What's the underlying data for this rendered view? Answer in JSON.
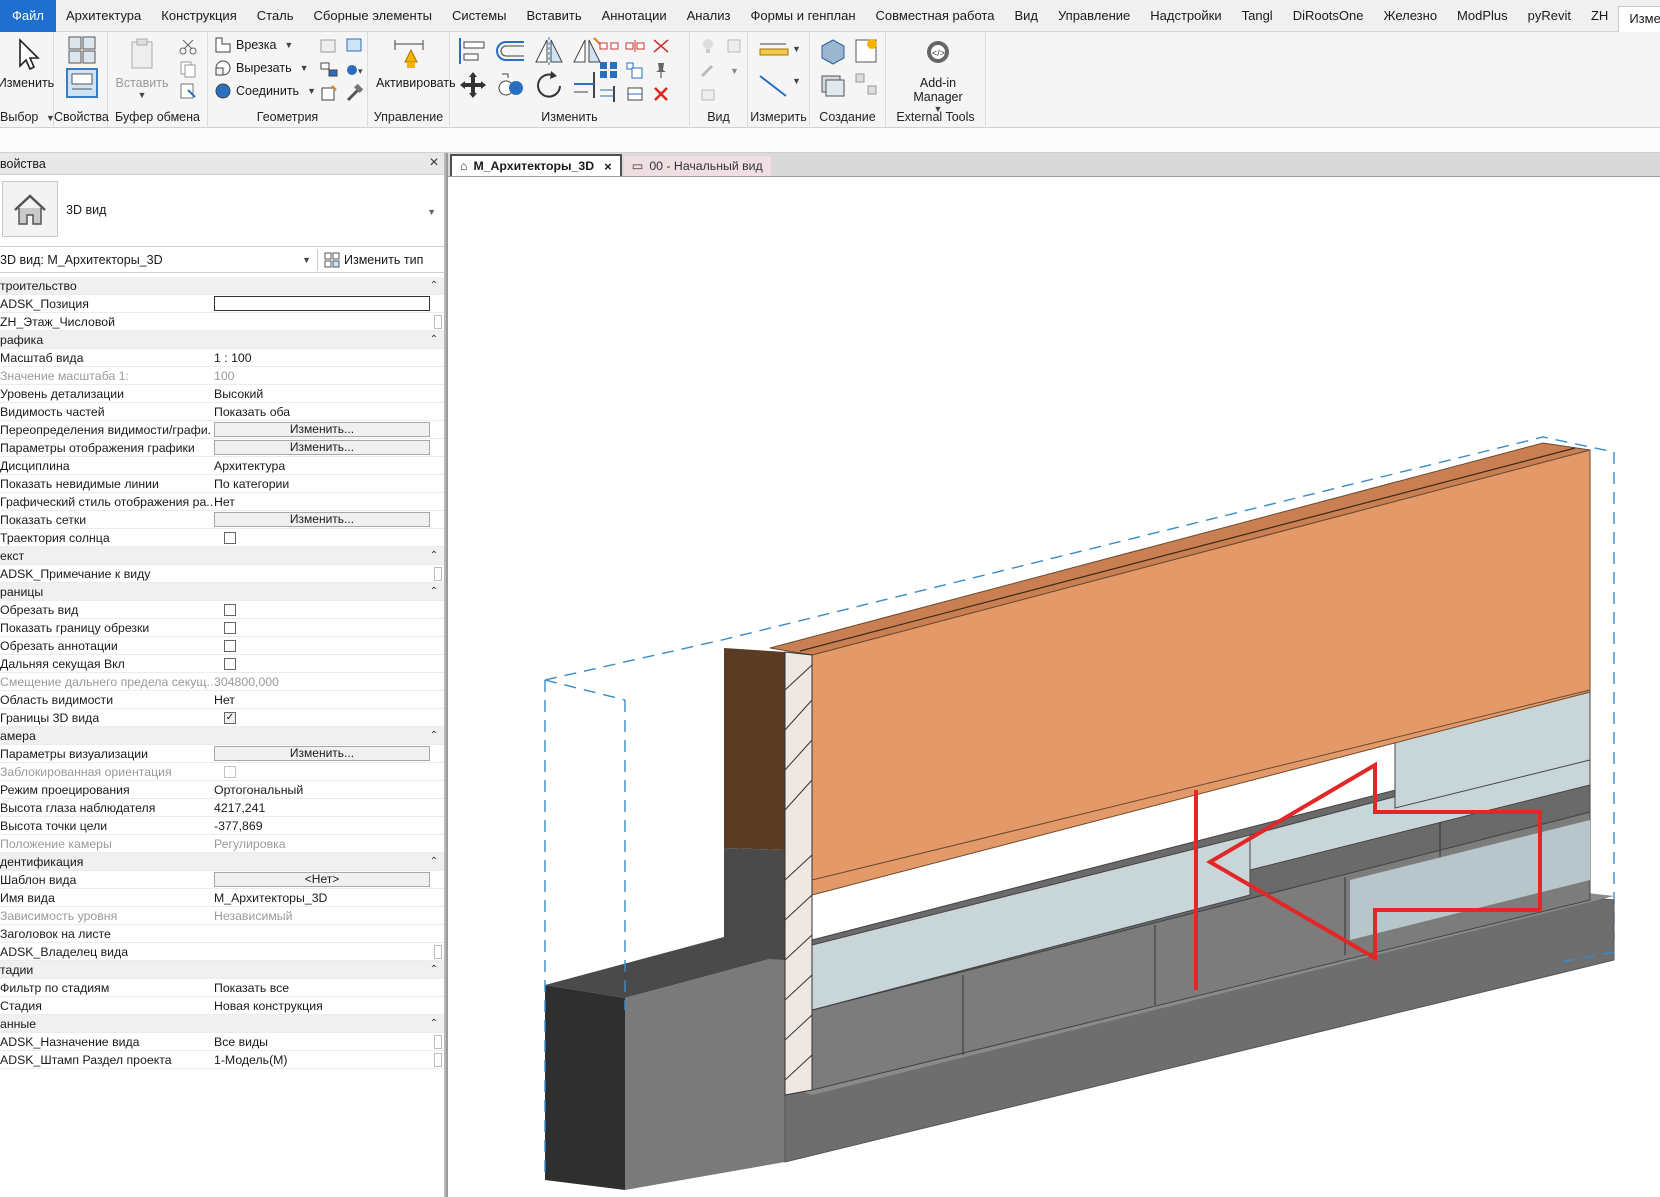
{
  "ribbon_tabs": [
    "Файл",
    "Архитектура",
    "Конструкция",
    "Сталь",
    "Сборные элементы",
    "Системы",
    "Вставить",
    "Аннотации",
    "Анализ",
    "Формы и генплан",
    "Совместная работа",
    "Вид",
    "Управление",
    "Надстройки",
    "Tangl",
    "DiRootsOne",
    "Железно",
    "ModPlus",
    "pyRevit",
    "ZH",
    "Изменить"
  ],
  "ribbon": {
    "select": {
      "btn": "Изменить",
      "title": "Выбор"
    },
    "properties": {
      "title": "Свойства"
    },
    "clipboard": {
      "paste": "Вставить",
      "title": "Буфер обмена"
    },
    "geometry": {
      "cope": "Врезка",
      "cut": "Вырезать",
      "join": "Соединить",
      "title": "Геометрия"
    },
    "control": {
      "activate": "Активировать",
      "title": "Управление"
    },
    "modify": {
      "title": "Изменить"
    },
    "view": {
      "title": "Вид"
    },
    "measure": {
      "title": "Измерить"
    },
    "create": {
      "title": "Создание"
    },
    "external": {
      "btn": "Add-in Manager",
      "title": "External Tools"
    }
  },
  "properties": {
    "header": "войства",
    "type_name": "3D вид",
    "selector": "3D вид: М_Архитекторы_3D",
    "edit_type": "Изменить тип",
    "rows": [
      {
        "kind": "group",
        "k": "троительство"
      },
      {
        "kind": "input",
        "k": "ADSK_Позиция"
      },
      {
        "kind": "text",
        "k": "ZH_Этаж_Числовой",
        "v": "",
        "scroll": true
      },
      {
        "kind": "group",
        "k": "рафика"
      },
      {
        "kind": "text",
        "k": "Масштаб вида",
        "v": " 1 : 100"
      },
      {
        "kind": "text",
        "k": "Значение масштаба    1:",
        "v": "100",
        "dis": true
      },
      {
        "kind": "text",
        "k": "Уровень детализации",
        "v": "Высокий"
      },
      {
        "kind": "text",
        "k": "Видимость частей",
        "v": "Показать оба"
      },
      {
        "kind": "btn",
        "k": "Переопределения видимости/графи...",
        "v": "Изменить..."
      },
      {
        "kind": "btn",
        "k": "Параметры отображения графики",
        "v": "Изменить..."
      },
      {
        "kind": "text",
        "k": "Дисциплина",
        "v": "Архитектура"
      },
      {
        "kind": "text",
        "k": "Показать невидимые линии",
        "v": "По категории"
      },
      {
        "kind": "text",
        "k": "Графический стиль отображения ра...",
        "v": "Нет"
      },
      {
        "kind": "btn",
        "k": "Показать сетки",
        "v": "Изменить..."
      },
      {
        "kind": "chk",
        "k": "Траектория солнца",
        "on": false
      },
      {
        "kind": "group",
        "k": "екст"
      },
      {
        "kind": "text",
        "k": "ADSK_Примечание к виду",
        "v": "",
        "scroll": true
      },
      {
        "kind": "group",
        "k": "раницы"
      },
      {
        "kind": "chk",
        "k": "Обрезать вид",
        "on": false
      },
      {
        "kind": "chk",
        "k": "Показать границу обрезки",
        "on": false
      },
      {
        "kind": "chk",
        "k": "Обрезать аннотации",
        "on": false
      },
      {
        "kind": "chk",
        "k": "Дальняя секущая Вкл",
        "on": false
      },
      {
        "kind": "text",
        "k": "Смещение дальнего предела секущ...",
        "v": "304800,000",
        "dis": true
      },
      {
        "kind": "text",
        "k": "Область видимости",
        "v": "Нет"
      },
      {
        "kind": "chk",
        "k": "Границы 3D вида",
        "on": true
      },
      {
        "kind": "group",
        "k": "амера"
      },
      {
        "kind": "btn",
        "k": "Параметры визуализации",
        "v": "Изменить..."
      },
      {
        "kind": "chk",
        "k": "Заблокированная ориентация",
        "on": false,
        "dis": true
      },
      {
        "kind": "text",
        "k": "Режим проецирования",
        "v": "Ортогональный"
      },
      {
        "kind": "text",
        "k": "Высота глаза наблюдателя",
        "v": "4217,241"
      },
      {
        "kind": "text",
        "k": "Высота точки цели",
        "v": "-377,869"
      },
      {
        "kind": "text",
        "k": "Положение камеры",
        "v": "Регулировка",
        "dis": true
      },
      {
        "kind": "group",
        "k": "дентификация"
      },
      {
        "kind": "btn",
        "k": "Шаблон вида",
        "v": "<Нет>"
      },
      {
        "kind": "text",
        "k": "Имя вида",
        "v": "М_Архитекторы_3D"
      },
      {
        "kind": "text",
        "k": "Зависимость уровня",
        "v": "Независимый",
        "dis": true
      },
      {
        "kind": "text",
        "k": "Заголовок на листе",
        "v": ""
      },
      {
        "kind": "text",
        "k": "ADSK_Владелец вида",
        "v": "",
        "scroll": true
      },
      {
        "kind": "group",
        "k": "тадии"
      },
      {
        "kind": "text",
        "k": "Фильтр по стадиям",
        "v": "Показать все"
      },
      {
        "kind": "text",
        "k": "Стадия",
        "v": "Новая конструкция"
      },
      {
        "kind": "group",
        "k": "анные"
      },
      {
        "kind": "text",
        "k": "ADSK_Назначение вида",
        "v": "Все виды",
        "scroll": true
      },
      {
        "kind": "text",
        "k": "ADSK_Штамп Раздел проекта",
        "v": "1-Модель(М)",
        "scroll": true
      }
    ]
  },
  "view_tabs": [
    {
      "label": "М_Архитекторы_3D",
      "active": true
    },
    {
      "label": "00 - Начальный вид",
      "active": false
    }
  ],
  "colors": {
    "brick": "#e49a68",
    "insulation": "#c9d6d9",
    "concrete": "#7a7a7a",
    "annotation": "#e32626",
    "crop": "#3a8bc9"
  }
}
